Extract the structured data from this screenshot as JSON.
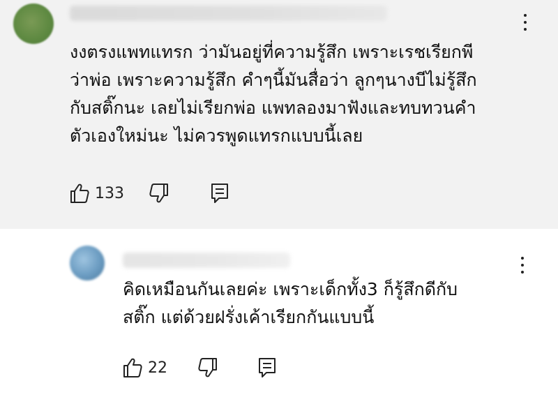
{
  "comments": [
    {
      "id": "top",
      "author": "",
      "text_lines": [
        "งงตรงแพทแทรก ว่ามันอยู่ที่ความรู้สึก เพราะเรชเรียกพี",
        "ว่าพ่อ เพราะความรู้สึก คำๆนี้มันสื่อว่า ลูกๆนางบีไม่รู้สึก",
        "กับสติ๊กนะ เลยไม่เรียกพ่อ แพทลองมาฟังและทบทวนคำ",
        "ตัวเองใหม่นะ ไม่ควรพูดแทรกแบบนี้เลย"
      ],
      "like_count": "133"
    },
    {
      "id": "reply",
      "author": "",
      "text_lines": [
        "คิดเหมือนกันเลยค่ะ เพราะเด็กทั้ง3 ก็รู้สึกดีกับ",
        "สติ๊ก แต่ด้วยฝรั่งเค้าเรียกกันแบบนี้"
      ],
      "like_count": "22"
    }
  ],
  "icons": {
    "like": "thumb-up-icon",
    "dislike": "thumb-down-icon",
    "reply": "reply-comment-icon",
    "menu": "more-vert-icon"
  },
  "colors": {
    "top_background": "#f2f2f2",
    "reply_background": "#ffffff",
    "text": "#111111"
  }
}
